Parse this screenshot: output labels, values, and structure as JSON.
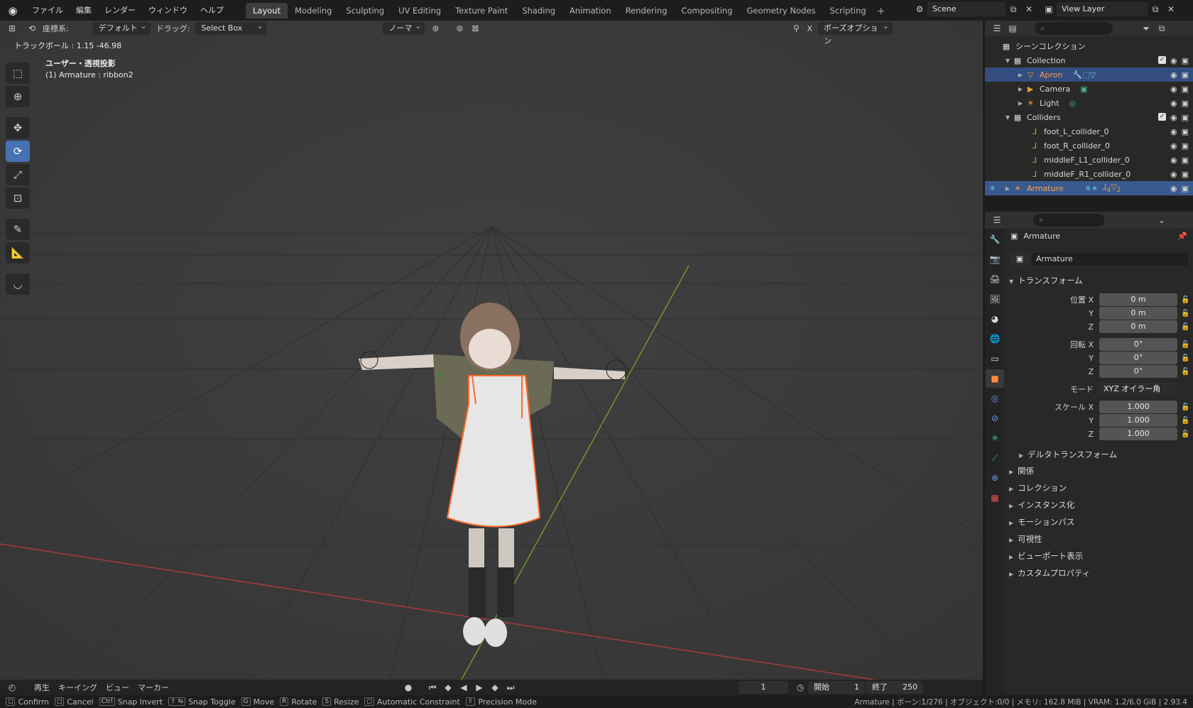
{
  "topbar": {
    "menus": [
      "ファイル",
      "編集",
      "レンダー",
      "ウィンドウ",
      "ヘルプ"
    ],
    "workspaces": [
      "Layout",
      "Modeling",
      "Sculpting",
      "UV Editing",
      "Texture Paint",
      "Shading",
      "Animation",
      "Rendering",
      "Compositing",
      "Geometry Nodes",
      "Scripting"
    ],
    "active_workspace": "Layout",
    "scene": "Scene",
    "view_layer": "View Layer"
  },
  "viewport": {
    "orientation_label": "座標系:",
    "orientation_value": "デフォルト",
    "drag_label": "ドラッグ:",
    "drag_value": "Select Box",
    "pivot_value": "ノーマ",
    "pose_options": "ポーズオプション",
    "x_mirror": "X",
    "trackball": "トラックボール : 1.15 -46.98",
    "view_name": "ユーザー・透視投影",
    "active_object": "(1) Armature : ribbon2"
  },
  "timeline": {
    "playback": "再生",
    "keying": "キーイング",
    "view": "ビュー",
    "marker": "マーカー",
    "current_frame": "1",
    "start_label": "開始",
    "start_value": "1",
    "end_label": "終了",
    "end_value": "250"
  },
  "statusbar": {
    "hints": [
      {
        "key": "◻",
        "label": "Confirm"
      },
      {
        "key": "◻",
        "label": "Cancel"
      },
      {
        "key": "Ctrl",
        "label": "Snap Invert"
      },
      {
        "key": "⇧ ⇆",
        "label": "Snap Toggle"
      },
      {
        "key": "G",
        "label": "Move"
      },
      {
        "key": "R",
        "label": "Rotate"
      },
      {
        "key": "S",
        "label": "Resize"
      },
      {
        "key": "◻",
        "label": "Automatic Constraint"
      },
      {
        "key": "⇧",
        "label": "Precision Mode"
      }
    ],
    "info": "Armature | ボーン:1/276 | オブジェクト:0/0 | メモリ: 162.8 MiB | VRAM: 1.2/6.0 GiB | 2.93.4"
  },
  "outliner": {
    "search_placeholder": "",
    "rows": [
      {
        "label": "シーンコレクション",
        "indent": 0
      },
      {
        "label": "Collection",
        "indent": 1
      },
      {
        "label": "Apron",
        "indent": 2
      },
      {
        "label": "Camera",
        "indent": 2
      },
      {
        "label": "Light",
        "indent": 2
      },
      {
        "label": "Colliders",
        "indent": 1
      },
      {
        "label": "foot_L_collider_0",
        "indent": 3
      },
      {
        "label": "foot_R_collider_0",
        "indent": 3
      },
      {
        "label": "middleF_L1_collider_0",
        "indent": 3
      },
      {
        "label": "middleF_R1_collider_0",
        "indent": 3
      },
      {
        "label": "Armature",
        "indent": 1
      }
    ],
    "badge_4": "4",
    "badge_2": "2"
  },
  "properties": {
    "object_name": "Armature",
    "object_field": "Armature",
    "transform_title": "トランスフォーム",
    "location_x_label": "位置 X",
    "y_label": "Y",
    "z_label": "Z",
    "loc_x": "0 m",
    "loc_y": "0 m",
    "loc_z": "0 m",
    "rotation_x_label": "回転 X",
    "rot_x": "0°",
    "rot_y": "0°",
    "rot_z": "0°",
    "mode_label": "モード",
    "mode_value": "XYZ オイラー角",
    "scale_x_label": "スケール X",
    "scale_x": "1.000",
    "scale_y": "1.000",
    "scale_z": "1.000",
    "delta_transform": "デルタトランスフォーム",
    "sections": [
      "関係",
      "コレクション",
      "インスタンス化",
      "モーションパス",
      "可視性",
      "ビューポート表示",
      "カスタムプロパティ"
    ]
  },
  "colors": {
    "accent_blue": "#4772b3",
    "selection_orange": "#ff8c3a",
    "axis_red": "#b03a3a",
    "axis_green": "#6a9a2a"
  }
}
